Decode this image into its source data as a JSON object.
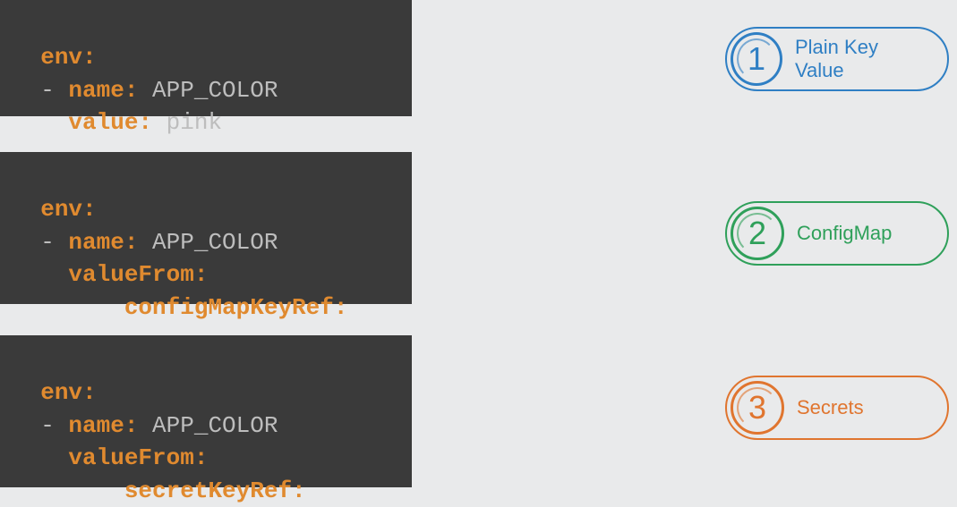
{
  "blocks": [
    {
      "tokens": [
        {
          "t": "env:",
          "c": "kw",
          "br": true
        },
        {
          "t": "  - ",
          "c": "val"
        },
        {
          "t": "name:",
          "c": "kw"
        },
        {
          "t": " APP_COLOR",
          "c": "val",
          "br": true
        },
        {
          "t": "    ",
          "c": "val"
        },
        {
          "t": "value:",
          "c": "kw"
        },
        {
          "t": " pink",
          "c": "val"
        }
      ]
    },
    {
      "tokens": [
        {
          "t": "env:",
          "c": "kw",
          "br": true
        },
        {
          "t": "  - ",
          "c": "val"
        },
        {
          "t": "name:",
          "c": "kw"
        },
        {
          "t": " APP_COLOR",
          "c": "val",
          "br": true
        },
        {
          "t": "    ",
          "c": "val"
        },
        {
          "t": "valueFrom:",
          "c": "kw",
          "br": true
        },
        {
          "t": "        ",
          "c": "val"
        },
        {
          "t": "configMapKeyRef:",
          "c": "kw"
        }
      ]
    },
    {
      "tokens": [
        {
          "t": "env:",
          "c": "kw",
          "br": true
        },
        {
          "t": "  - ",
          "c": "val"
        },
        {
          "t": "name:",
          "c": "kw"
        },
        {
          "t": " APP_COLOR",
          "c": "val",
          "br": true
        },
        {
          "t": "    ",
          "c": "val"
        },
        {
          "t": "valueFrom:",
          "c": "kw",
          "br": true
        },
        {
          "t": "        ",
          "c": "val"
        },
        {
          "t": "secretKeyRef:",
          "c": "kw"
        }
      ]
    }
  ],
  "badges": [
    {
      "num": "1",
      "label": "Plain Key Value",
      "color": "blue"
    },
    {
      "num": "2",
      "label": "ConfigMap",
      "color": "green"
    },
    {
      "num": "3",
      "label": "Secrets",
      "color": "orange"
    }
  ]
}
